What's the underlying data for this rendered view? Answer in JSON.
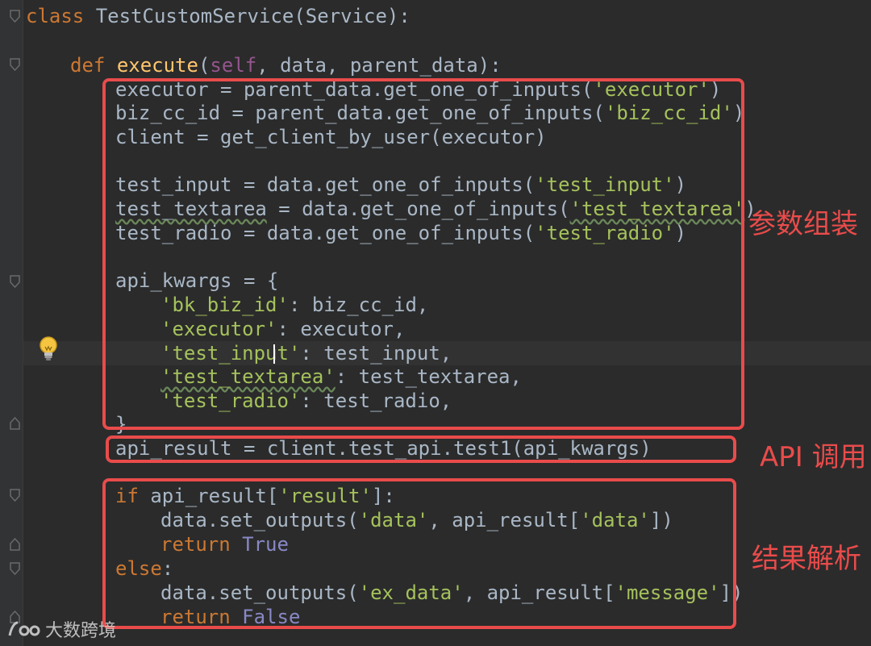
{
  "editor": {
    "class_kw": "class",
    "class_decl": "TestCustomService(Service):",
    "def_kw": "def",
    "def_name": "execute",
    "def_open": "(",
    "def_self": "self",
    "def_params": ", data, parent_data):",
    "line_executor_a": "executor = parent_data.get_one_of_inputs(",
    "line_executor_s": "'executor'",
    "line_executor_c": ")",
    "line_biz_a": "biz_cc_id = parent_data.get_one_of_inputs(",
    "line_biz_s": "'biz_cc_id'",
    "line_biz_c": ")",
    "line_client": "client = get_client_by_user(executor)",
    "line_ti_a": "test_input = data.get_one_of_inputs(",
    "line_ti_s": "'test_input'",
    "line_ti_c": ")",
    "line_tt_name": "test_textarea",
    "line_tt_a": " = data.get_one_of_inputs(",
    "line_tt_s": "'test_textarea'",
    "line_tt_c": ")",
    "line_tr_a": "test_radio = data.get_one_of_inputs(",
    "line_tr_s": "'test_radio'",
    "line_tr_c": ")",
    "line_kwargs": "api_kwargs = {",
    "kv1_k": "'bk_biz_id'",
    "kv1_v": ": biz_cc_id,",
    "kv2_k": "'executor'",
    "kv2_v": ": executor,",
    "kv3_k": "'test_input'",
    "kv3_v": ": test_input,",
    "kv4_k": "'test_textarea'",
    "kv4_v": ": test_textarea,",
    "kv5_k": "'test_radio'",
    "kv5_v": ": test_radio,",
    "line_close": "}",
    "line_result": "api_result = client.test_api.test1(api_kwargs)",
    "if_kw": "if",
    "if_a": " api_result[",
    "if_s": "'result'",
    "if_c": "]:",
    "so1_a": "data.set_outputs(",
    "so1_s1": "'data'",
    "so1_b": ", api_result[",
    "so1_s2": "'data'",
    "so1_c": "])",
    "ret_kw": "return",
    "true_val": " True",
    "else_kw": "else",
    "else_c": ":",
    "so2_a": "data.set_outputs(",
    "so2_s1": "'ex_data'",
    "so2_b": ", api_result[",
    "so2_s2": "'message'",
    "so2_c": "])",
    "false_val": " False"
  },
  "annotations": {
    "param_assembly": "参数组装",
    "api_call": "API 调用",
    "result_parse": "结果解析"
  },
  "watermark": {
    "text": "大数跨境",
    "icon": "brand-logo-icon"
  },
  "icons": {
    "bulb": "lightbulb-icon",
    "fold": "fold-marker-icon"
  },
  "colors": {
    "background": "#2b2b2b",
    "keyword": "#cc7832",
    "function": "#ffc66d",
    "string": "#a5c25c",
    "annotation": "#e94b4b",
    "self": "#94558d",
    "constant": "#8888c6"
  }
}
